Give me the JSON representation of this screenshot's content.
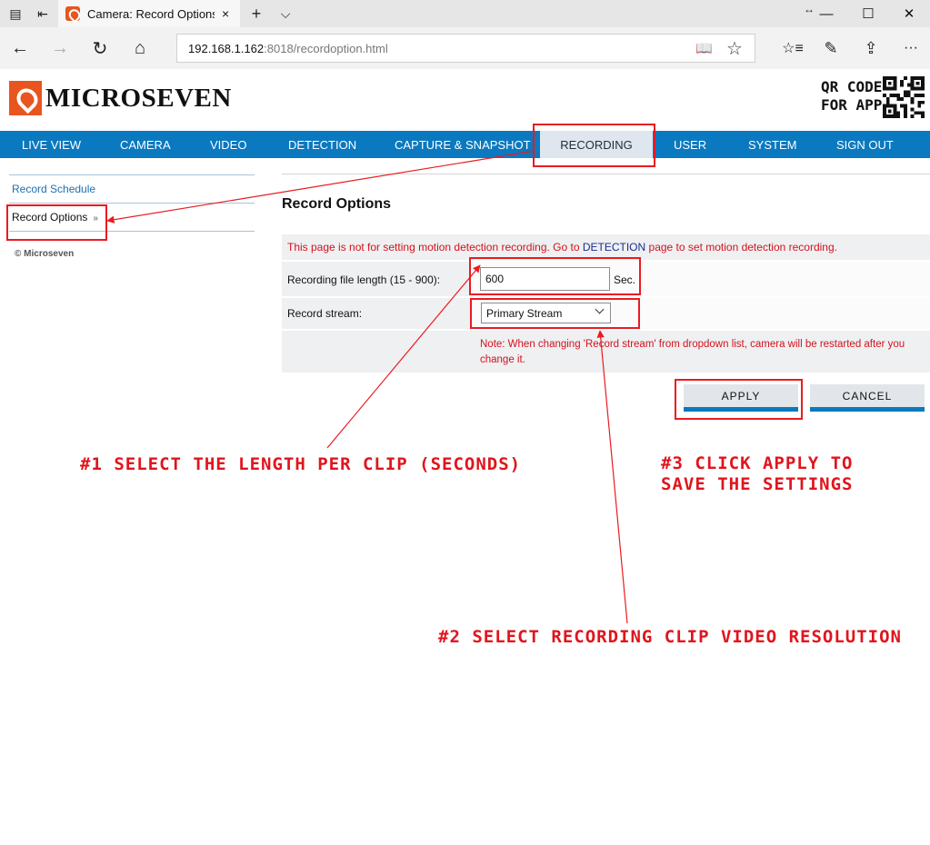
{
  "browser": {
    "tab_title": "Camera: Record Options",
    "tab_close": "×",
    "new_tab": "+",
    "tab_list": "⌵",
    "window_drag": "↔",
    "minimize": "—",
    "maximize": "☐",
    "close": "✕",
    "back": "←",
    "forward": "→",
    "refresh": "↻",
    "home": "⌂",
    "url_host": "192.168.1.162",
    "url_rest": ":8018/recordoption.html",
    "reading_view": "📖",
    "favorite": "☆",
    "favorites_hub": "☆≡",
    "notes": "✎",
    "share": "⇪",
    "more": "···"
  },
  "header": {
    "logo_text": "MICROSEVEN",
    "qr_line1": "QR CODE",
    "qr_line2": "FOR APP"
  },
  "menu": {
    "items": [
      {
        "label": "LIVE VIEW"
      },
      {
        "label": "CAMERA"
      },
      {
        "label": "VIDEO"
      },
      {
        "label": "DETECTION"
      },
      {
        "label": "CAPTURE & SNAPSHOT"
      },
      {
        "label": "RECORDING",
        "active": true
      },
      {
        "label": "USER"
      },
      {
        "label": "SYSTEM"
      },
      {
        "label": "SIGN OUT"
      }
    ]
  },
  "sidebar": {
    "items": [
      {
        "label": "Record Schedule"
      },
      {
        "label": "Record Options",
        "chevron": "»"
      }
    ],
    "copyright": "© Microseven"
  },
  "main": {
    "title": "Record Options",
    "warning_pre": "This page is not for setting motion detection recording. Go to ",
    "warning_link": "DETECTION",
    "warning_post": " page to set motion detection recording.",
    "file_length_label": "Recording file length (15 - 900):",
    "file_length_value": "600",
    "file_length_unit": "Sec.",
    "stream_label": "Record stream:",
    "stream_value": "Primary Stream",
    "note": "Note: When changing 'Record stream' from dropdown list, camera will be restarted after you change it.",
    "apply_label": "APPLY",
    "cancel_label": "CANCEL"
  },
  "annotations": {
    "step1": "#1 SELECT THE LENGTH PER CLIP (SECONDS)",
    "step2": "#2 SELECT RECORDING CLIP VIDEO RESOLUTION",
    "step3_line1": "#3 CLICK APPLY TO",
    "step3_line2": "SAVE THE SETTINGS",
    "color": "#ea1b21"
  },
  "colors": {
    "accent": "#0b79bf",
    "brand": "#e8551e",
    "warning": "#d4121b"
  }
}
